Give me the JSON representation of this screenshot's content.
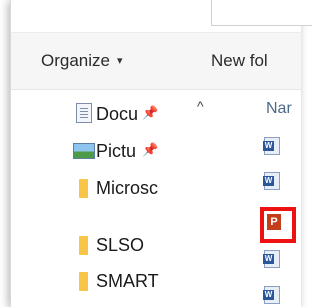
{
  "toolbar": {
    "organize_label": "Organize",
    "organize_caret": "▾",
    "new_folder_label": "New fol"
  },
  "nav": {
    "items": [
      {
        "label": "Docu",
        "icon": "document-icon",
        "pinned": true
      },
      {
        "label": "Pictu",
        "icon": "pictures-icon",
        "pinned": true
      },
      {
        "label": "Microsc",
        "icon": "folder-icon",
        "pinned": false
      },
      {
        "label": "SLSO",
        "icon": "folder-icon",
        "pinned": false
      },
      {
        "label": "SMART",
        "icon": "folder-icon",
        "pinned": false
      }
    ],
    "pin_glyph": "📌",
    "collapse_glyph": "^"
  },
  "content": {
    "column_header": "Nar",
    "files": [
      {
        "type": "word",
        "badge": "W"
      },
      {
        "type": "word",
        "badge": "W"
      },
      {
        "type": "powerpoint",
        "badge": "P",
        "highlighted": true
      },
      {
        "type": "word",
        "badge": "W"
      },
      {
        "type": "word",
        "badge": "W"
      }
    ]
  },
  "colors": {
    "highlight_border": "#ee1111",
    "folder": "#f7c548",
    "word_blue": "#2b579a",
    "ppt_orange": "#c43e1c"
  }
}
